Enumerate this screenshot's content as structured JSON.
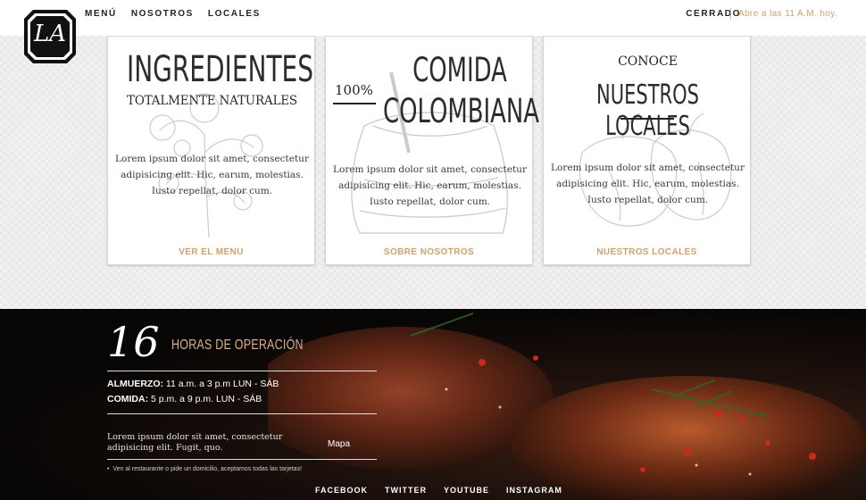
{
  "header": {
    "logo_text": "LA",
    "nav": [
      "MENÚ",
      "NOSOTROS",
      "LOCALES"
    ],
    "status": "CERRADO",
    "opens": "Abre a las 11 A.M. hoy."
  },
  "cards": [
    {
      "title": "INGREDIENTES",
      "subtitle": "TOTALMENTE NATURALES",
      "body": "Lorem ipsum dolor sit amet, consectetur adipisicing elit. Hic, earum, molestias. Iusto repellat, dolor cum.",
      "link": "VER EL MENU"
    },
    {
      "badge": "100%",
      "title_line1": "COMIDA",
      "title_line2": "COLOMBIANA",
      "body": "Lorem ipsum dolor sit amet, consectetur adipisicing elit. Hic, earum, molestias. Iusto repellat, dolor cum.",
      "link": "SOBRE NOSOTROS"
    },
    {
      "kicker": "CONOCE",
      "title": "NUESTROS LOCALES",
      "body": "Lorem ipsum dolor sit amet, consectetur adipisicing elit. Hic, earum, molestias. Iusto repellat, dolor cum.",
      "link": "NUESTROS LOCALES"
    }
  ],
  "hours": {
    "number": "16",
    "title": "HORAS DE OPERACIÓN",
    "lunch_label": "ALMUERZO:",
    "lunch_value": " 11 a.m. a 3 p.m LUN - SÁB",
    "dinner_label": "COMIDA:",
    "dinner_value": " 5 p.m. a 9 p.m. LUN - SÁB",
    "description": "Lorem ipsum dolor sit amet, consectetur adipisicing elit. Fugit, quo.",
    "map_label": "Mapa",
    "note": "Ven al restaurante o pide un domicilio, aceptamos todas las tarjetas!"
  },
  "social": [
    "FACEBOOK",
    "TWITTER",
    "YOUTUBE",
    "INSTAGRAM"
  ],
  "colors": {
    "accent": "#d4a06a",
    "dark": "#0a0807"
  }
}
